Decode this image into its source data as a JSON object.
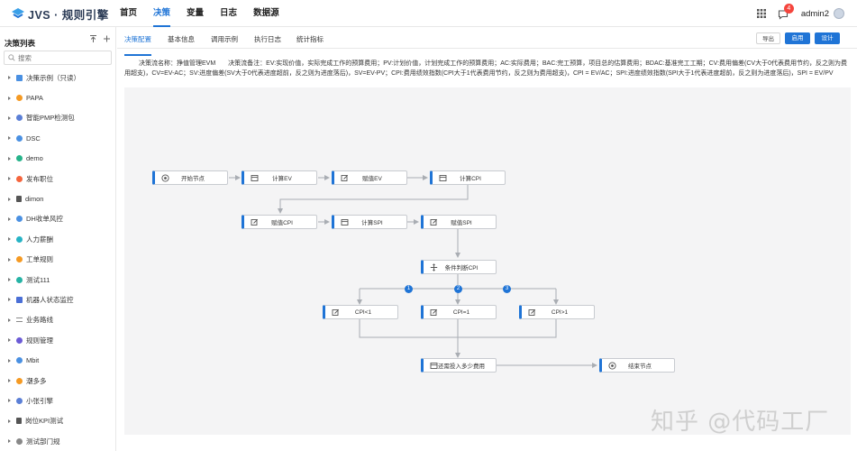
{
  "app": {
    "logo_text": "JVS · 规则引擎"
  },
  "nav": {
    "items": [
      "首页",
      "决策",
      "变量",
      "日志",
      "数据源"
    ],
    "active_index": 1
  },
  "topbar": {
    "notification_count": "4",
    "username": "admin2"
  },
  "sidebar": {
    "title": "决策列表",
    "search_placeholder": "搜索",
    "items": [
      {
        "label": "决策示例（只读）",
        "icon": "folder-icon",
        "color": "#4a90e2"
      },
      {
        "label": "PAPA",
        "icon": "dot-icon",
        "color": "#f59a23"
      },
      {
        "label": "智能PMP检测包",
        "icon": "dot-icon",
        "color": "#5b7fd6"
      },
      {
        "label": "DSC",
        "icon": "dot-icon",
        "color": "#4a90e2"
      },
      {
        "label": "demo",
        "icon": "dot-icon",
        "color": "#26b38a"
      },
      {
        "label": "发布职位",
        "icon": "dot-icon",
        "color": "#f5653d"
      },
      {
        "label": "dimon",
        "icon": "branch-icon",
        "color": "#555555"
      },
      {
        "label": "DH收单风控",
        "icon": "dot-icon",
        "color": "#4a90e2"
      },
      {
        "label": "人力薪酬",
        "icon": "dot-icon",
        "color": "#26b3c5"
      },
      {
        "label": "工单规则",
        "icon": "dot-icon",
        "color": "#f59a23"
      },
      {
        "label": "测试111",
        "icon": "dot-icon",
        "color": "#26b3a5"
      },
      {
        "label": "机器人状态监控",
        "icon": "square-icon",
        "color": "#4a6fd6"
      },
      {
        "label": "业务路线",
        "icon": "lines-icon",
        "color": "#888888"
      },
      {
        "label": "规则管理",
        "icon": "dot-icon",
        "color": "#6b5bd6"
      },
      {
        "label": "Mbit",
        "icon": "dot-icon",
        "color": "#4a90e2"
      },
      {
        "label": "潮多多",
        "icon": "dot-icon",
        "color": "#f59a23"
      },
      {
        "label": "小张引擎",
        "icon": "dot-icon",
        "color": "#5b7fd6"
      },
      {
        "label": "岗位KPI测试",
        "icon": "home-icon",
        "color": "#555555"
      },
      {
        "label": "测试部门规",
        "icon": "dot-icon",
        "color": "#888888"
      }
    ]
  },
  "tabs": [
    "决策配置",
    "基本信息",
    "调用示例",
    "执行日志",
    "统计指标"
  ],
  "active_tab": 0,
  "buttons": {
    "export": "导出",
    "enable": "启用",
    "design": "设计"
  },
  "description": {
    "name": "决策流名称：挣值管理EVM",
    "note": "决策流备注：EV:实现价值，实际完成工作的预算费用；PV:计划价值，计划完成工作的预算费用；AC:实际费用；BAC:完工预算，项目总的估算费用；BDAC:基准完工工期；CV:费用偏差(CV大于0代表费用节约，反之则为费用超支)，CV=EV-AC；SV:进度偏差(SV大于0代表进度超前，反之则为进度落后)，SV=EV-PV；CPI:费用绩效指数(CPI大于1代表费用节约，反之则为费用超支)，CPI = EV/AC；SPI:进度绩效指数(SPI大于1代表进度超前，反之则为进度落后)，SPI = EV/PV"
  },
  "flow": {
    "nodes": [
      {
        "label": "开始节点",
        "icon": "play-circle-icon"
      },
      {
        "label": "计算EV",
        "icon": "calculator-icon"
      },
      {
        "label": "赋值EV",
        "icon": "edit-icon"
      },
      {
        "label": "计算CPI",
        "icon": "calculator-icon"
      },
      {
        "label": "赋值CPI",
        "icon": "edit-icon"
      },
      {
        "label": "计算SPI",
        "icon": "calculator-icon"
      },
      {
        "label": "赋值SPI",
        "icon": "edit-icon"
      },
      {
        "label": "条件判断CPI",
        "icon": "branch-cross-icon"
      },
      {
        "label": "CPI<1",
        "icon": "edit-icon"
      },
      {
        "label": "CPI=1",
        "icon": "edit-icon"
      },
      {
        "label": "CPI>1",
        "icon": "edit-icon"
      },
      {
        "label": "还需投入多少费用",
        "icon": "calculator-icon"
      },
      {
        "label": "结束节点",
        "icon": "play-circle-icon"
      }
    ],
    "branch_numbers": [
      "1",
      "2",
      "3"
    ]
  },
  "watermark": "知乎 @代码工厂"
}
